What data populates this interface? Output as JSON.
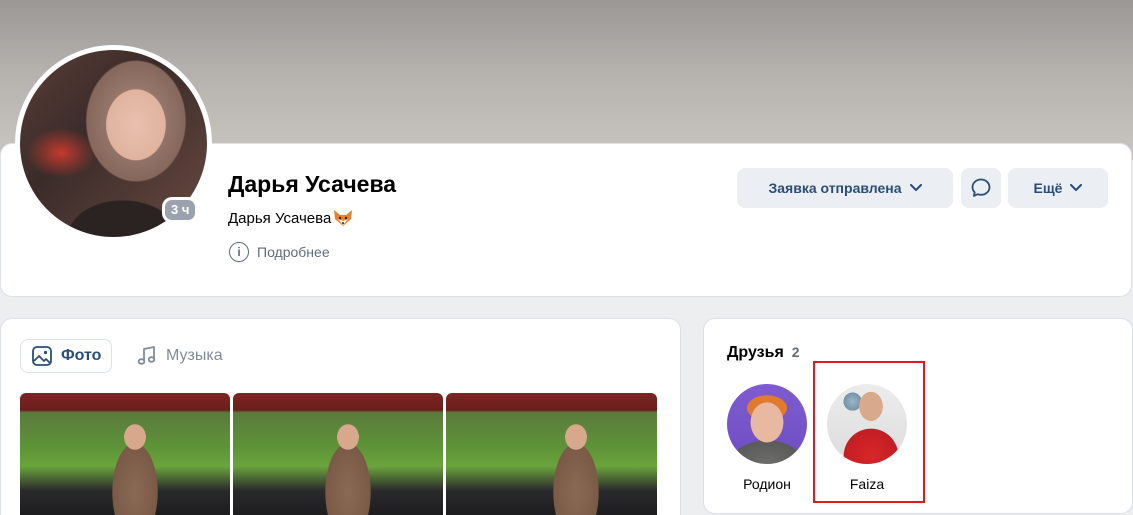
{
  "profile": {
    "name": "Дарья Усачева",
    "status": "Дарья Усачева",
    "last_seen": "3 ч",
    "more_info": "Подробнее",
    "buttons": {
      "request": "Заявка отправлена",
      "more": "Ещё"
    }
  },
  "media": {
    "tabs": [
      {
        "label": "Фото",
        "icon": "image-icon"
      },
      {
        "label": "Музыка",
        "icon": "music-note-icon"
      }
    ]
  },
  "friends": {
    "title": "Друзья",
    "count": "2",
    "items": [
      {
        "name": "Родион"
      },
      {
        "name": "Faiza"
      }
    ]
  },
  "colors": {
    "accent": "#2a4e77",
    "button_bg": "#ebeef3",
    "highlight": "#e01b24",
    "secondary_text": "#626d7a"
  }
}
